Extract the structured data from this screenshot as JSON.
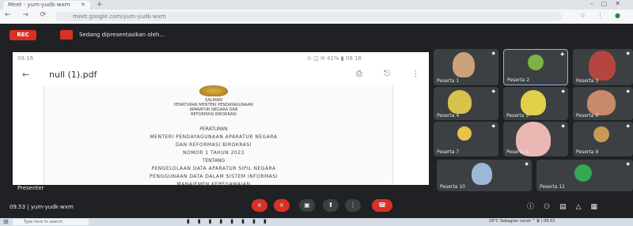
{
  "browser": {
    "tab_title": "Meet - yum-yudk-wxm",
    "url": "meet.google.com/yum-yudk-wxm",
    "nav": "← → ⟳"
  },
  "meet": {
    "recording_label": "REC",
    "presenting_text": "Sedang dipresentasikan oleh...",
    "presenter_name": "Presenter",
    "meeting_time": "09.53 | yum-yudk-wxm"
  },
  "document": {
    "status_left": "09.16",
    "status_right": "⊙ ◫ ✉ 41% ▮ 09.16",
    "file_name": "null (1).pdf",
    "lines": [
      "SALINAN",
      "PERATURAN MENTERI PENDAYAGUNAAN",
      "APARATUR NEGARA DAN",
      "REFORMASI BIROKRASI",
      "PERATURAN",
      "MENTERI PENDAYAGUNAAN APARATUR NEGARA",
      "DAN REFORMASI BIROKRASI",
      "NOMOR 1 TAHUN 2023",
      "TENTANG",
      "PENGELOLAAN DATA APARATUR SIPIL NEGARA",
      "PENGGUNAAN DATA DALAM SISTEM INFORMASI",
      "MANAJEMEN KEPEGAWAIAN"
    ]
  },
  "participants": [
    {
      "name": "Peserta 1"
    },
    {
      "name": "Peserta 2"
    },
    {
      "name": "Peserta 3"
    },
    {
      "name": "Peserta 4"
    },
    {
      "name": "Peserta 5"
    },
    {
      "name": "Peserta 6"
    },
    {
      "name": "Peserta 7"
    },
    {
      "name": "Peserta 8"
    },
    {
      "name": "Peserta 9"
    },
    {
      "name": "Peserta 10"
    },
    {
      "name": "Peserta 11"
    }
  ],
  "taskbar": {
    "search_placeholder": "Type here to search",
    "tray": "29°C  Sebagian cerah  ^ ⧉ ) 09.53"
  },
  "colors": {
    "meet_bg": "#202124",
    "tile_bg": "#3c4043",
    "danger": "#d93025",
    "accent": "#8ab4f8",
    "avatar_green": "#34a853"
  }
}
